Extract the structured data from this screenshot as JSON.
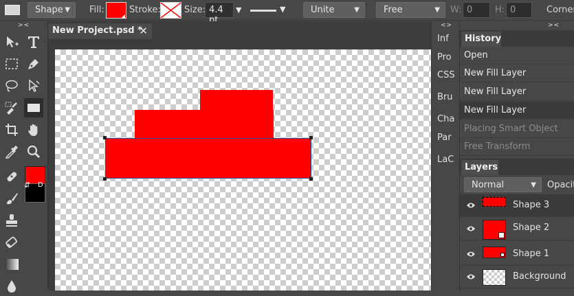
{
  "topbar": {
    "tool_mode": "Shape",
    "fill_label": "Fill:",
    "stroke_label": "Stroke:",
    "size_label": "Size:",
    "size_value": "4.4 pt",
    "combine_mode": "Unite",
    "constraint": "Free",
    "w_label": "W:",
    "w_value": "0",
    "h_label": "H:",
    "h_value": "0",
    "corner_label": "Corner",
    "fill_color": "#ff0000"
  },
  "collapse_glyph": "><",
  "expand_glyph": "<>",
  "document": {
    "tab_title": "New Project.psd *",
    "close_glyph": "✕"
  },
  "colors": {
    "foreground": "#ff0000",
    "background": "#000000",
    "shape": "#ff0000",
    "swap_glyph": "⇵",
    "default_glyph": "D"
  },
  "mid_panels": [
    "Inf",
    "Pro",
    "CSS",
    "Bru",
    "Cha",
    "Par",
    "LaC"
  ],
  "history": {
    "title": "History",
    "items": [
      {
        "label": "Open",
        "dim": false
      },
      {
        "label": "New Fill Layer",
        "dim": false
      },
      {
        "label": "New Fill Layer",
        "dim": false
      },
      {
        "label": "New Fill Layer",
        "dim": false
      },
      {
        "label": "Placing Smart Object",
        "dim": true
      },
      {
        "label": "Free Transform",
        "dim": true
      }
    ]
  },
  "layers": {
    "title": "Layers",
    "blend_mode": "Normal",
    "opacity_label": "Opacit",
    "items": [
      {
        "name": "Shape 3"
      },
      {
        "name": "Shape 2"
      },
      {
        "name": "Shape 1"
      },
      {
        "name": "Background"
      }
    ]
  }
}
